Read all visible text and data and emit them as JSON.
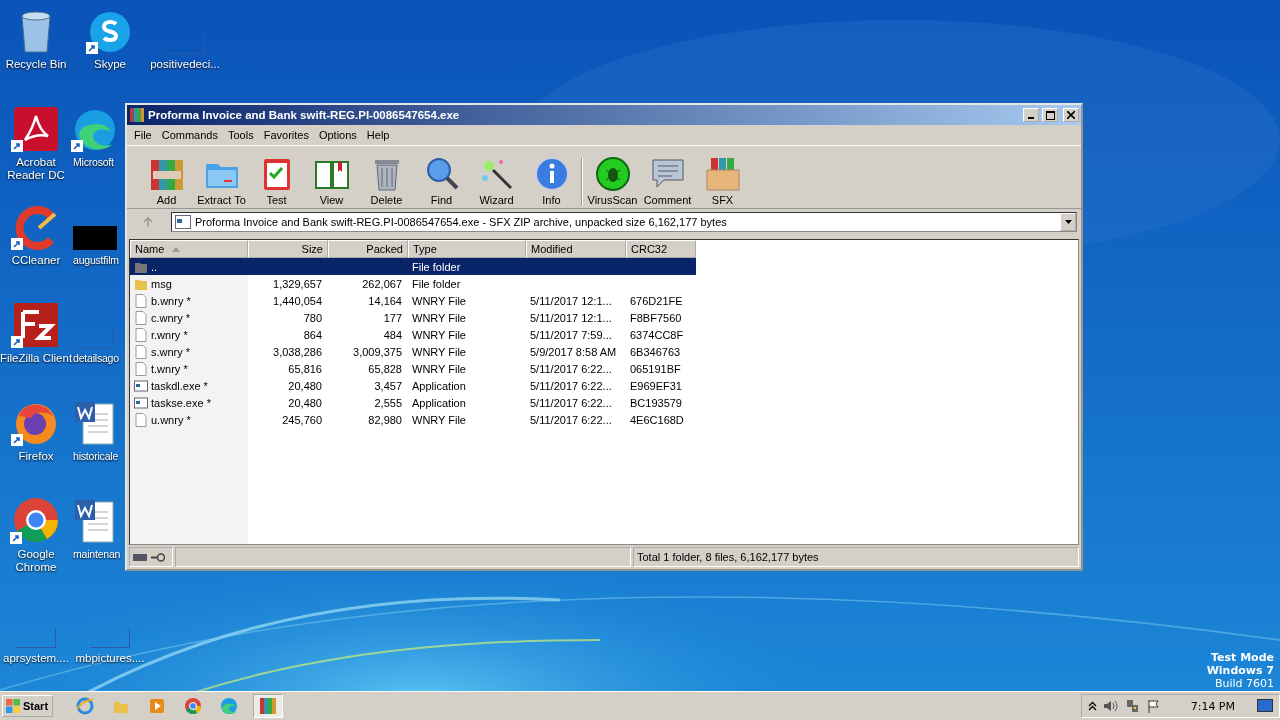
{
  "desktop_icons": [
    {
      "label": "Recycle Bin",
      "kind": "recycle",
      "shortcut": false
    },
    {
      "label": "Skype",
      "kind": "skype",
      "shortcut": true
    },
    {
      "label": "positivedeci...",
      "kind": "blank",
      "shortcut": false
    },
    {
      "label": "Acrobat Reader DC",
      "kind": "acrobat",
      "shortcut": true
    },
    {
      "label": "Microsoft",
      "kind": "edge",
      "shortcut": true
    },
    {
      "label": "CCleaner",
      "kind": "ccleaner",
      "shortcut": true
    },
    {
      "label": "augustfilm",
      "kind": "black",
      "shortcut": false
    },
    {
      "label": "FileZilla Client",
      "kind": "filezilla",
      "shortcut": true
    },
    {
      "label": "detailsago",
      "kind": "blank",
      "shortcut": false
    },
    {
      "label": "Firefox",
      "kind": "firefox",
      "shortcut": true
    },
    {
      "label": "historicale",
      "kind": "word",
      "shortcut": false
    },
    {
      "label": "Google Chrome",
      "kind": "chrome",
      "shortcut": true
    },
    {
      "label": "maintenan",
      "kind": "word",
      "shortcut": false
    },
    {
      "label": "aprsystem....",
      "kind": "blank",
      "shortcut": false
    },
    {
      "label": "mbpictures....",
      "kind": "blank",
      "shortcut": false
    }
  ],
  "window": {
    "title": "Proforma Invoice and Bank swift-REG.PI-0086547654.exe",
    "menu": [
      "File",
      "Commands",
      "Tools",
      "Favorites",
      "Options",
      "Help"
    ],
    "toolbar": [
      {
        "label": "Add",
        "kind": "add"
      },
      {
        "label": "Extract To",
        "kind": "extract"
      },
      {
        "label": "Test",
        "kind": "test"
      },
      {
        "label": "View",
        "kind": "view"
      },
      {
        "label": "Delete",
        "kind": "delete"
      },
      {
        "label": "Find",
        "kind": "find"
      },
      {
        "label": "Wizard",
        "kind": "wizard"
      },
      {
        "label": "Info",
        "kind": "info"
      },
      {
        "label": "VirusScan",
        "kind": "virus"
      },
      {
        "label": "Comment",
        "kind": "comment"
      },
      {
        "label": "SFX",
        "kind": "sfx"
      }
    ],
    "address": "Proforma Invoice and Bank swift-REG.PI-0086547654.exe - SFX ZIP archive, unpacked size 6,162,177 bytes",
    "columns": [
      "Name",
      "Size",
      "Packed",
      "Type",
      "Modified",
      "CRC32"
    ],
    "rows": [
      {
        "kind": "up",
        "name": "..",
        "size": "",
        "packed": "",
        "type": "File folder",
        "modified": "",
        "crc32": "",
        "selected": true
      },
      {
        "kind": "folder",
        "name": "msg",
        "size": "1,329,657",
        "packed": "262,067",
        "type": "File folder",
        "modified": "",
        "crc32": "",
        "selected": false
      },
      {
        "kind": "file",
        "name": "b.wnry *",
        "size": "1,440,054",
        "packed": "14,164",
        "type": "WNRY File",
        "modified": "5/11/2017 12:1...",
        "crc32": "676D21FE",
        "selected": false
      },
      {
        "kind": "file",
        "name": "c.wnry *",
        "size": "780",
        "packed": "177",
        "type": "WNRY File",
        "modified": "5/11/2017 12:1...",
        "crc32": "F8BF7560",
        "selected": false
      },
      {
        "kind": "file",
        "name": "r.wnry *",
        "size": "864",
        "packed": "484",
        "type": "WNRY File",
        "modified": "5/11/2017 7:59...",
        "crc32": "6374CC8F",
        "selected": false
      },
      {
        "kind": "file",
        "name": "s.wnry *",
        "size": "3,038,286",
        "packed": "3,009,375",
        "type": "WNRY File",
        "modified": "5/9/2017 8:58 AM",
        "crc32": "6B346763",
        "selected": false
      },
      {
        "kind": "file",
        "name": "t.wnry *",
        "size": "65,816",
        "packed": "65,828",
        "type": "WNRY File",
        "modified": "5/11/2017 6:22...",
        "crc32": "065191BF",
        "selected": false
      },
      {
        "kind": "exe",
        "name": "taskdl.exe *",
        "size": "20,480",
        "packed": "3,457",
        "type": "Application",
        "modified": "5/11/2017 6:22...",
        "crc32": "E969EF31",
        "selected": false
      },
      {
        "kind": "exe",
        "name": "taskse.exe *",
        "size": "20,480",
        "packed": "2,555",
        "type": "Application",
        "modified": "5/11/2017 6:22...",
        "crc32": "BC193579",
        "selected": false
      },
      {
        "kind": "file",
        "name": "u.wnry *",
        "size": "245,760",
        "packed": "82,980",
        "type": "WNRY File",
        "modified": "5/11/2017 6:22...",
        "crc32": "4E6C168D",
        "selected": false
      }
    ],
    "status": "Total 1 folder, 8 files, 6,162,177 bytes"
  },
  "taskbar": {
    "start": "Start",
    "apps": [
      {
        "kind": "ie",
        "selected": false
      },
      {
        "kind": "explorer",
        "selected": false
      },
      {
        "kind": "media",
        "selected": false
      },
      {
        "kind": "chrome",
        "selected": false
      },
      {
        "kind": "edge",
        "selected": false
      },
      {
        "kind": "winrar",
        "selected": true
      }
    ],
    "clock": "7:14 PM"
  },
  "os_notice": [
    "Test Mode",
    "Windows 7",
    "Build 7601"
  ]
}
